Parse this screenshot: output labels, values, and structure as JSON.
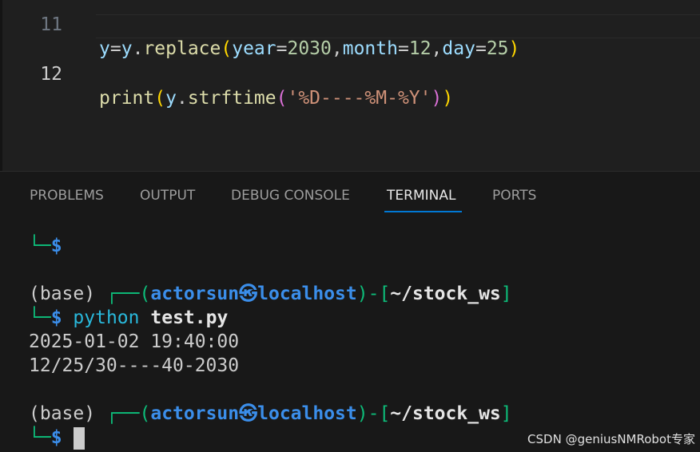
{
  "editor": {
    "lines": [
      {
        "number": "11",
        "tokens": [
          "y",
          "=",
          "y",
          ".",
          "replace",
          "(",
          "year",
          "=",
          "2030",
          ",",
          "month",
          "=",
          "12",
          ",",
          "day",
          "=",
          "25",
          ")"
        ]
      },
      {
        "number": "12",
        "tokens": [
          "print",
          "(",
          "y",
          ".",
          "strftime",
          "(",
          "'%D----%M-%Y'",
          ")",
          ")"
        ]
      }
    ]
  },
  "panel": {
    "tabs": [
      "PROBLEMS",
      "OUTPUT",
      "DEBUG CONSOLE",
      "TERMINAL",
      "PORTS"
    ],
    "active_tab": "TERMINAL"
  },
  "terminal": {
    "prompt_tail": "└─",
    "prompt_symbol": "$",
    "env": "(base)",
    "box_open": "┌──(",
    "user": "actorsun",
    "at_symbol": "㉿",
    "host": "localhost",
    "box_mid": ")-[",
    "cwd": "~/stock_ws",
    "box_close": "]",
    "command": "python",
    "command_arg": "test.py",
    "output": [
      "2025-01-02 19:40:00",
      "12/25/30----40-2030"
    ]
  },
  "watermark": "CSDN @geniusNMRobot专家"
}
